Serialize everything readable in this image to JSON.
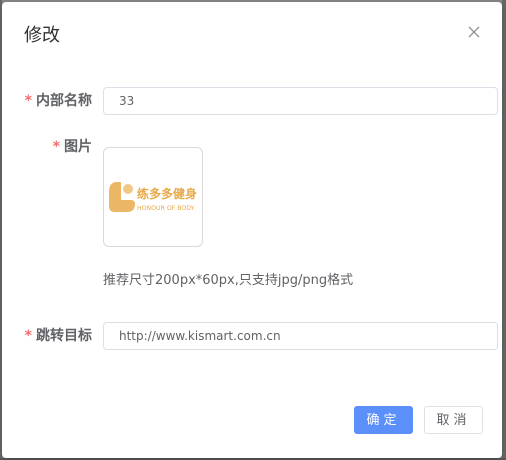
{
  "dialog": {
    "title": "修改",
    "close_icon": "close-icon"
  },
  "form": {
    "required_mark": "*",
    "name_label": "内部名称",
    "name_value": "33",
    "image_label": "图片",
    "image_hint": "推荐尺寸200px*60px,只支持jpg/png格式",
    "logo": {
      "text_cn": "练多多健身",
      "text_en": "HONOUR OF BODY",
      "brand_color": "#e8a94a"
    },
    "target_label": "跳转目标",
    "target_value": "http://www.kismart.com.cn"
  },
  "footer": {
    "confirm_label": "确定",
    "cancel_label": "取消"
  },
  "colors": {
    "primary": "#5b8ff9",
    "required": "#f56c6c"
  }
}
